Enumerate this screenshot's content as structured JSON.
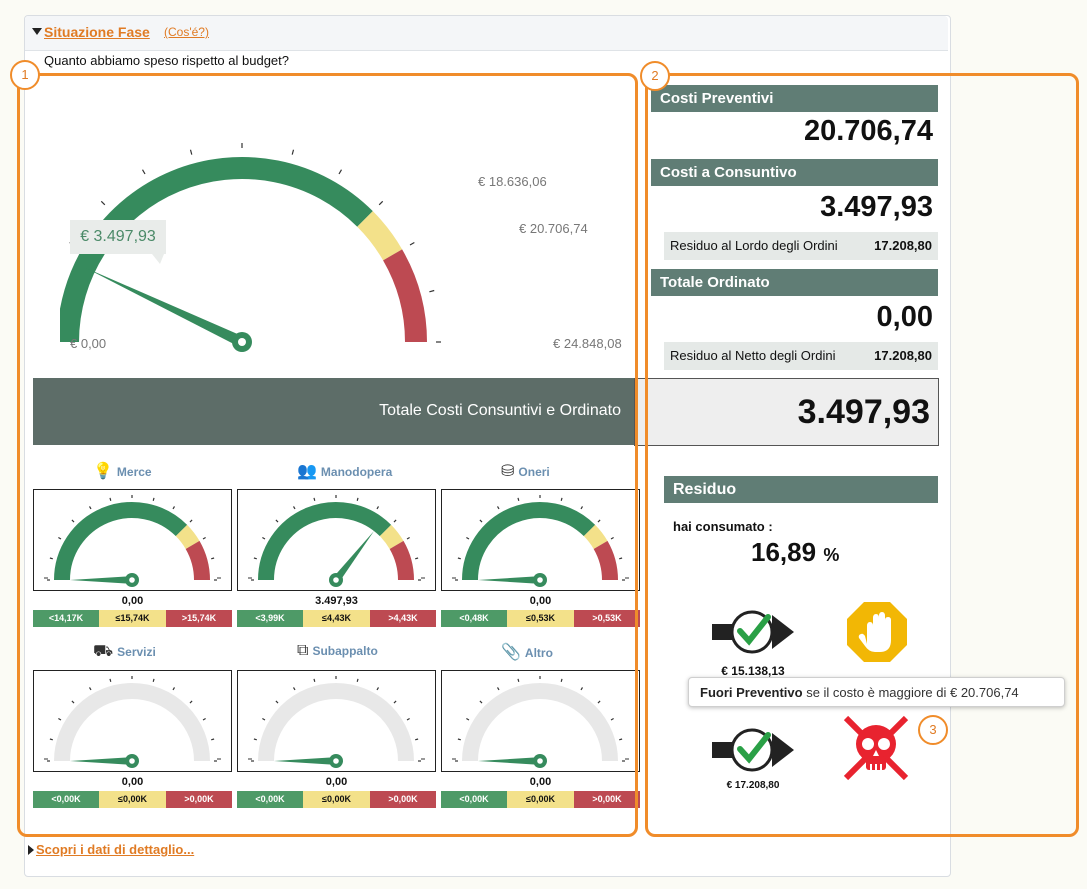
{
  "section": {
    "title": "Situazione Fase",
    "help_link": "(Cos'é?)",
    "question": "Quanto abbiamo speso rispetto al budget?"
  },
  "callouts": [
    "1",
    "2",
    "3"
  ],
  "main_gauge": {
    "value_bubble": "€ 3.497,93",
    "min_label": "€ 0,00",
    "mid_label_1": "€ 18.636,06",
    "mid_label_2": "€ 20.706,74",
    "max_label": "€ 24.848,08",
    "value_fraction": 0.1408,
    "zones": {
      "green_end": 0.75,
      "yellow_end": 0.833
    }
  },
  "banner": {
    "label": "Totale Costi Consuntivi e Ordinato",
    "value": "3.497,93"
  },
  "right_panel": {
    "costi_preventivi": {
      "title": "Costi Preventivi",
      "value": "20.706,74"
    },
    "costi_consuntivo": {
      "title": "Costi a Consuntivo",
      "value": "3.497,93",
      "residuo_label": "Residuo al Lordo degli Ordini",
      "residuo_value": "17.208,80"
    },
    "totale_ordinato": {
      "title": "Totale Ordinato",
      "value": "0,00",
      "residuo_label": "Residuo al Netto degli Ordini",
      "residuo_value": "17.208,80"
    },
    "residuo": {
      "title": "Residuo",
      "consumed_label": "hai consumato :",
      "consumed_value": "16,89",
      "consumed_unit": "%"
    },
    "arrow_1_value": "€ 15.138,13",
    "arrow_2_value": "€ 17.208,80",
    "tooltip": {
      "bold": "Fuori Preventivo",
      "text": " se il costo è maggiore di € 20.706,74"
    }
  },
  "mini_gauges": [
    {
      "name": "Merce",
      "icon": "lightbulb-icon",
      "value": "0,00",
      "legend": [
        "<14,17K",
        "≤15,74K",
        ">15,74K"
      ],
      "active": true,
      "fraction": 0.0
    },
    {
      "name": "Manodopera",
      "icon": "workers-icon",
      "value": "3.497,93",
      "legend": [
        "<3,99K",
        "≤4,43K",
        ">4,43K"
      ],
      "active": true,
      "fraction": 0.71
    },
    {
      "name": "Oneri",
      "icon": "coins-icon",
      "value": "0,00",
      "legend": [
        "<0,48K",
        "≤0,53K",
        ">0,53K"
      ],
      "active": true,
      "fraction": 0.0
    },
    {
      "name": "Servizi",
      "icon": "forklift-icon",
      "value": "0,00",
      "legend": [
        "<0,00K",
        "≤0,00K",
        ">0,00K"
      ],
      "active": false,
      "fraction": 0.0
    },
    {
      "name": "Subappalto",
      "icon": "subcontract-icon",
      "value": "0,00",
      "legend": [
        "<0,00K",
        "≤0,00K",
        ">0,00K"
      ],
      "active": false,
      "fraction": 0.0
    },
    {
      "name": "Altro",
      "icon": "paperclip-icon",
      "value": "0,00",
      "legend": [
        "<0,00K",
        "≤0,00K",
        ">0,00K"
      ],
      "active": false,
      "fraction": 0.0
    }
  ],
  "footer": {
    "more_link": "Scopri i dati di dettaglio..."
  },
  "colors": {
    "green": "#3a8c5c",
    "yellow": "#f3e18a",
    "red": "#bd4a52",
    "orange": "#f08c2a",
    "header": "#607d75"
  }
}
